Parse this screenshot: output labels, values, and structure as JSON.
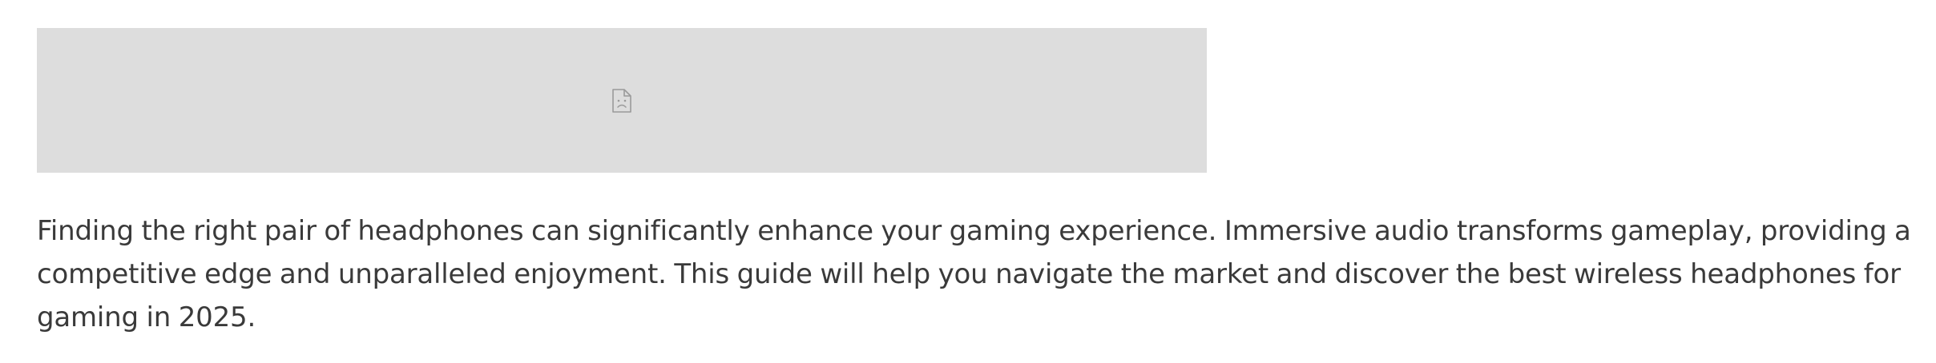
{
  "article": {
    "image": {
      "state": "broken",
      "icon": "broken-image-icon"
    },
    "intro_paragraph": "Finding the right pair of headphones can significantly enhance your gaming experience. Immersive audio transforms gameplay, providing a competitive edge and unparalleled enjoyment. This guide will help you navigate the market and discover the best wireless headphones for gaming in 2025."
  },
  "colors": {
    "placeholder_background": "#dddddd",
    "body_text": "#3a3a3a",
    "icon_stroke": "#9a9a9a"
  }
}
